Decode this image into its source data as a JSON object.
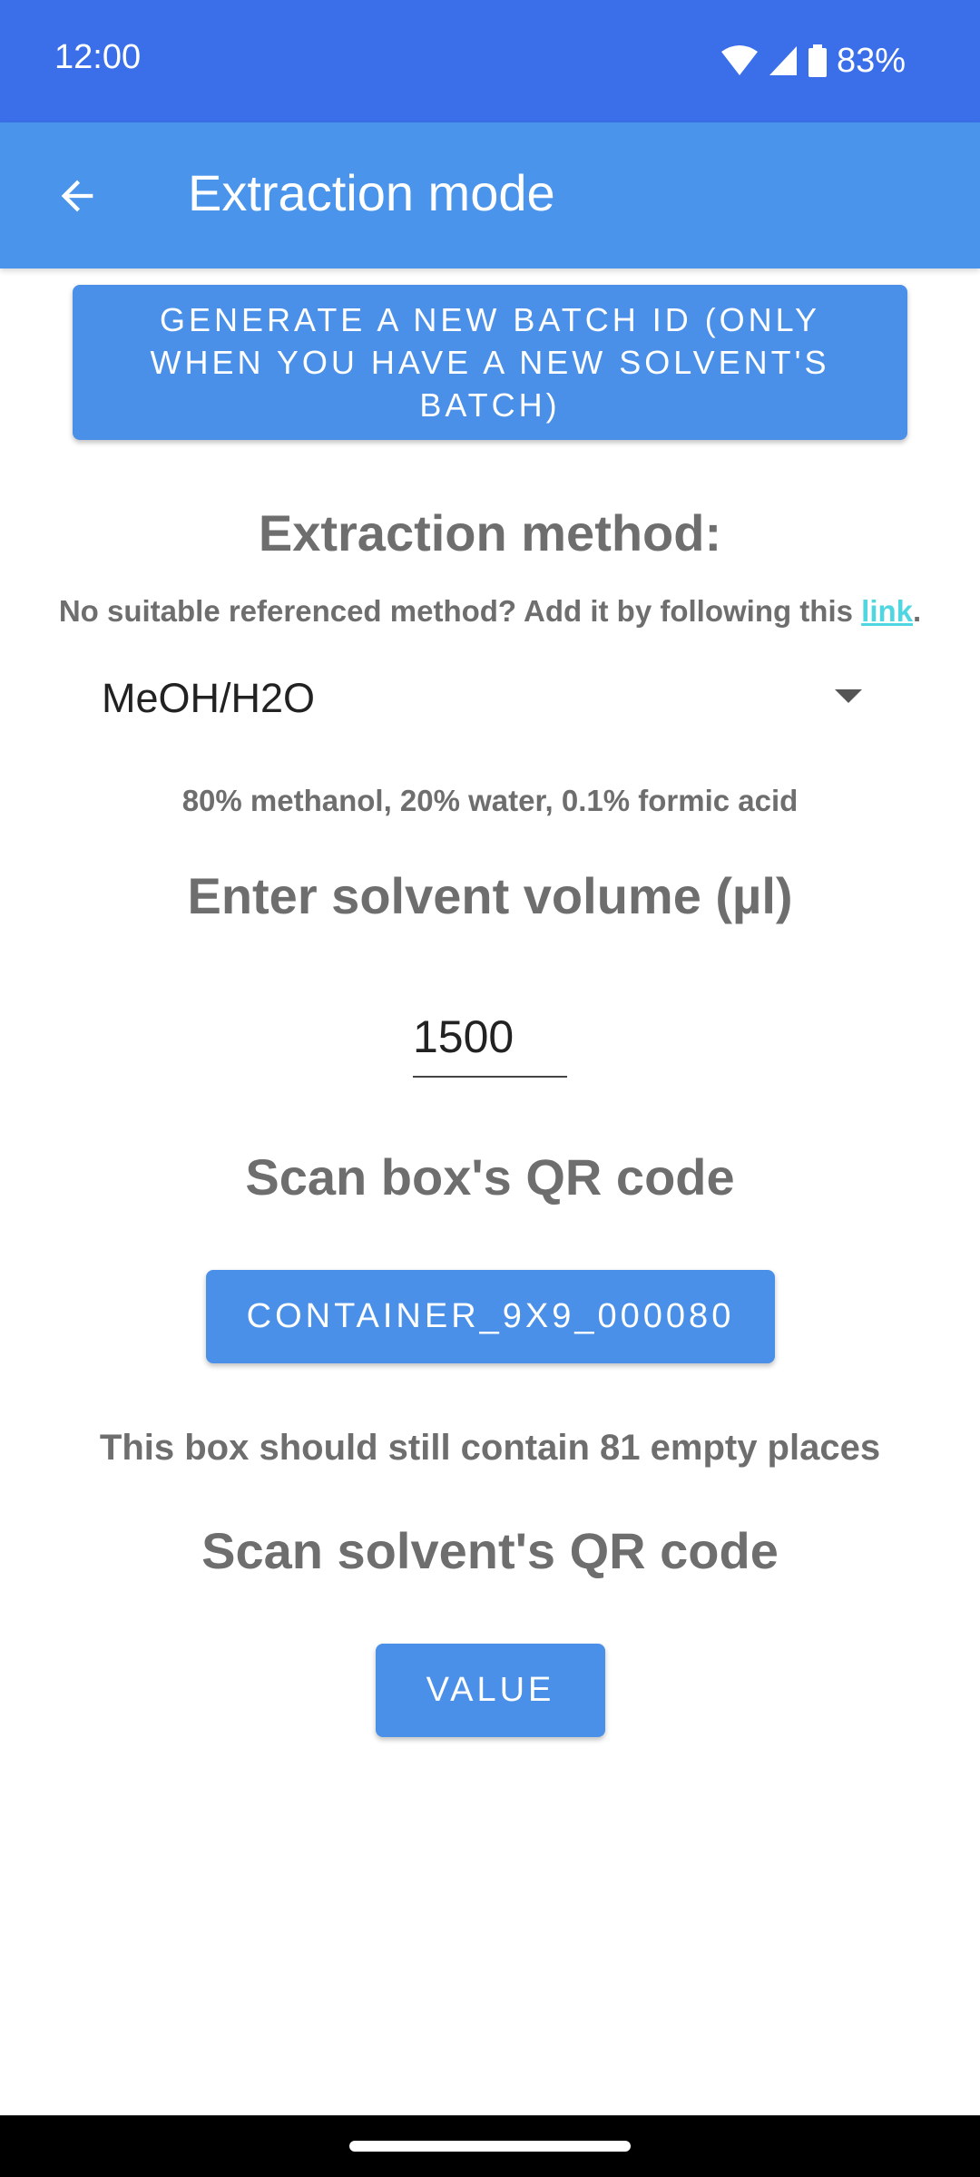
{
  "status_bar": {
    "time": "12:00",
    "battery": "83%",
    "icons": [
      "wifi-icon",
      "cellular-signal-icon",
      "battery-icon"
    ]
  },
  "app_bar": {
    "title": "Extraction mode",
    "back_icon": "arrow-back-icon"
  },
  "batch_button": {
    "label": "GENERATE A  NEW BATCH ID (ONLY WHEN YOU HAVE A NEW SOLVENT'S BATCH)"
  },
  "method": {
    "heading": "Extraction method:",
    "helper_prefix": "No suitable referenced method? Add it by following this ",
    "helper_link": "link",
    "helper_suffix": ".",
    "selected": "MeOH/H2O",
    "description": "80% methanol, 20% water, 0.1% formic acid"
  },
  "volume": {
    "heading": "Enter solvent volume (µl)",
    "value": "1500"
  },
  "box": {
    "heading": "Scan box's QR code",
    "button_label": "CONTAINER_9X9_000080",
    "info": "This box should still contain 81 empty places"
  },
  "solvent": {
    "heading": "Scan solvent's QR code",
    "button_label": "VALUE"
  },
  "colors": {
    "status_bar": "#3b6fe9",
    "app_bar": "#4a95eb",
    "button": "#4a90e8",
    "link": "#4fd6e0",
    "text_gray": "#6e6e6e"
  }
}
